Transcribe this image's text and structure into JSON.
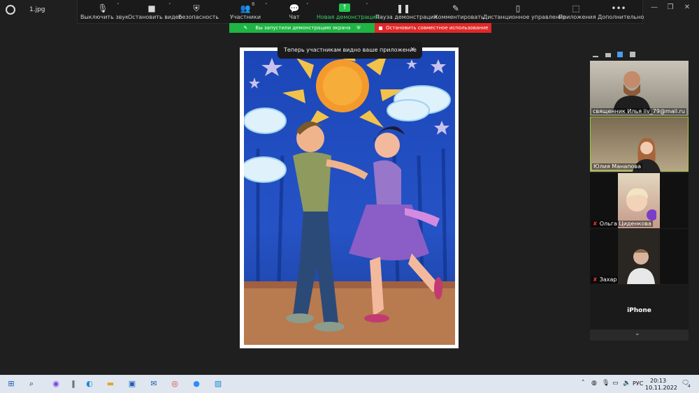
{
  "window": {
    "file_name": "1.jpg"
  },
  "toolbar": {
    "mute": "Выключить звук",
    "stop_video": "Остановить видео",
    "security": "Безопасность",
    "participants": "Участники",
    "participants_count": "8",
    "chat": "Чат",
    "new_share": "Новая демонстрация",
    "pause_share": "Пауза демонстрации",
    "annotate": "Комментировать",
    "remote_control": "Дистанционное управление",
    "apps": "Приложения",
    "more": "Дополнительно"
  },
  "banner": {
    "sharing": "Вы запустили демонстрацию экрана",
    "stop": "Остановить совместное использование"
  },
  "tooltip": {
    "text": "Теперь участникам видно ваше приложение",
    "close": "×"
  },
  "participants": [
    {
      "name": "священник Илья iiv_79@mail.ru"
    },
    {
      "name": "Юлия Манапова"
    },
    {
      "name": "Ольга Циденкова",
      "muted": true
    },
    {
      "name": "Захар",
      "muted": true
    },
    {
      "name": "iPhone"
    }
  ],
  "taskbar": {
    "time": "20:13",
    "date": "10.11.2022",
    "lang": "РУС",
    "notifications": "4"
  },
  "colors": {
    "share_green": "#1fb443",
    "stop_red": "#e02828",
    "active_tile_border": "#9ccf3e"
  }
}
